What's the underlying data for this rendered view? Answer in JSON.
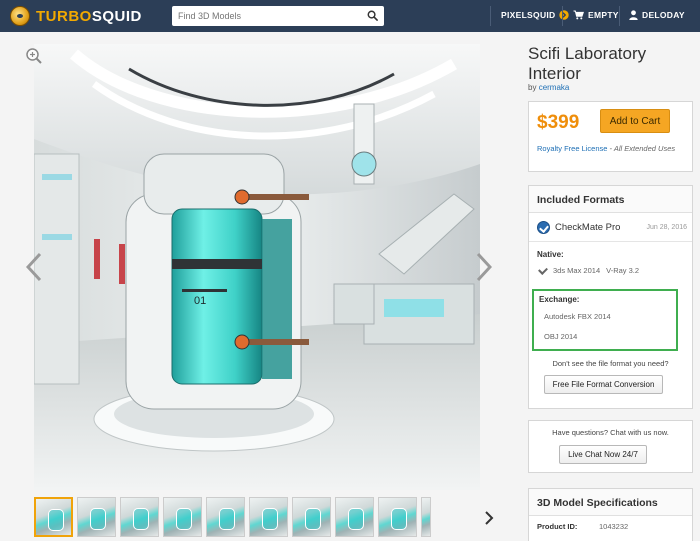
{
  "header": {
    "logo_text_a": "TURBO",
    "logo_text_b": "SQUID",
    "search_placeholder": "Find 3D Models",
    "pixelsquid_label": "PIXELSQUID",
    "cart_label": "EMPTY",
    "user_label": "DELODAY"
  },
  "product": {
    "title": "Scifi Laboratory Interior",
    "by_prefix": "by",
    "author": "cermaka",
    "price": "$399",
    "add_to_cart": "Add to Cart",
    "license_link": "Royalty Free License",
    "license_rest": " - All Extended Uses"
  },
  "formats": {
    "title": "Included Formats",
    "checkmate_label": "CheckMate Pro",
    "checkmate_date": "Jun 28, 2016",
    "native_label": "Native:",
    "native_software": "3ds Max 2014",
    "native_renderer": "V-Ray 3.2",
    "exchange_label": "Exchange:",
    "exchange_items": [
      "Autodesk FBX 2014",
      "OBJ 2014"
    ],
    "question": "Don't see the file format you need?",
    "conversion_button": "Free File Format Conversion"
  },
  "chat": {
    "question": "Have questions? Chat with us now.",
    "button": "Live Chat Now 24/7"
  },
  "specs": {
    "title": "3D Model Specifications",
    "product_id_label": "Product ID:",
    "product_id": "1043232"
  },
  "gallery": {
    "thumbnail_count": 10,
    "active_index": 0
  },
  "colors": {
    "header_bg": "#2c3e57",
    "brand_orange": "#f2a900",
    "price": "#ef8e0b",
    "cart_button": "#f5a623",
    "link": "#1e6fb5",
    "exchange_border": "#3fae4f"
  }
}
